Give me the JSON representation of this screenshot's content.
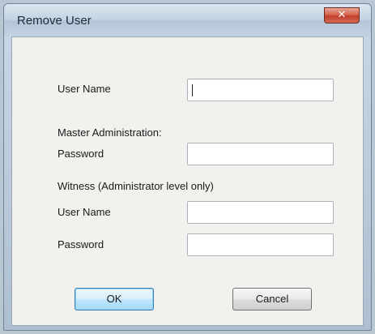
{
  "window": {
    "title": "Remove User"
  },
  "form": {
    "user_name_label": "User Name",
    "user_name_value": "",
    "master_section_label": "Master Administration:",
    "master_password_label": "Password",
    "master_password_value": "",
    "witness_section_label": "Witness (Administrator level only)",
    "witness_user_name_label": "User Name",
    "witness_user_name_value": "",
    "witness_password_label": "Password",
    "witness_password_value": ""
  },
  "buttons": {
    "ok": "OK",
    "cancel": "Cancel"
  },
  "colors": {
    "close_button": "#c9503c",
    "default_button_border": "#3c7fb1",
    "client_bg": "#f2f1ee"
  }
}
